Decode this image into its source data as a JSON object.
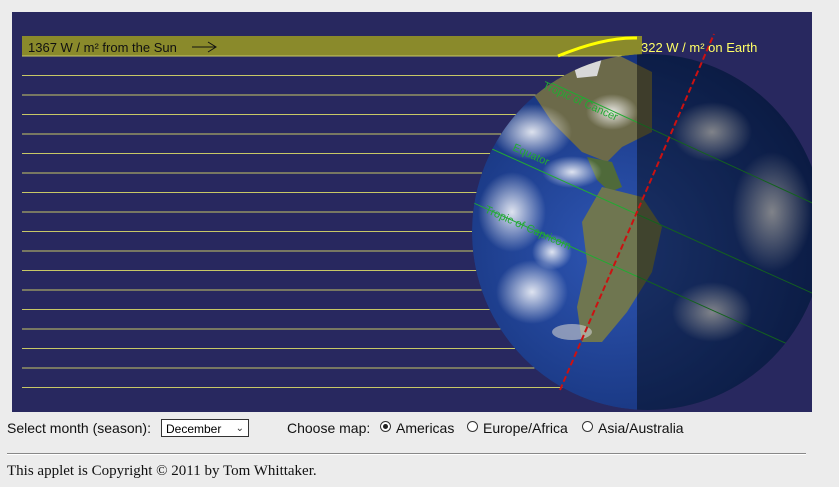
{
  "diagram": {
    "sun_label": "1367 W / m² from the Sun",
    "earth_label": "322 W / m² on Earth",
    "equator_label": "Equator",
    "tropic_cancer_label": "Tropic of Cancer",
    "tropic_capricorn_label": "Tropic of Capricorn",
    "colors": {
      "background": "#28285f",
      "sunbeam_band": "#8a8a2b",
      "sunbeam_line": "#c8c866",
      "earth_arc": "#ffff00",
      "earth_label": "#ffff66",
      "axis": "#cc1111",
      "latitude_lines": "#22aa33"
    }
  },
  "controls": {
    "month_label": "Select month (season):",
    "month_selected": "December",
    "map_label": "Choose map:",
    "map_options": [
      "Americas",
      "Europe/Africa",
      "Asia/Australia"
    ],
    "map_selected": "Americas"
  },
  "footer": {
    "copyright": "This applet is Copyright © 2011 by Tom Whittaker."
  }
}
